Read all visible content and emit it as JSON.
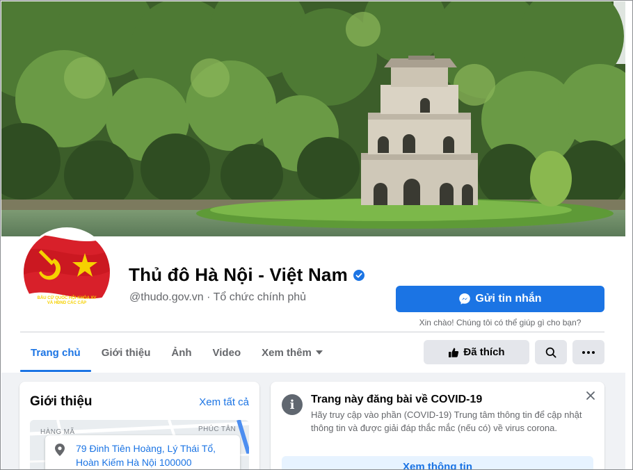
{
  "header": {
    "title": "Thủ đô Hà Nội - Việt Nam",
    "handle": "@thudo.gov.vn · Tổ chức chính phủ",
    "verified": true,
    "avatar_text": [
      "BẦU CỬ QUỐC HỘI KHÓA XV",
      "VÀ HĐND CÁC CẤP",
      "2021-2026"
    ]
  },
  "actions": {
    "message_label": "Gửi tin nhắn",
    "message_hint": "Xin chào! Chúng tôi có thể giúp gì cho bạn?",
    "liked_label": "Đã thích"
  },
  "tabs": [
    {
      "label": "Trang chủ",
      "active": true
    },
    {
      "label": "Giới thiệu",
      "active": false
    },
    {
      "label": "Ảnh",
      "active": false
    },
    {
      "label": "Video",
      "active": false
    },
    {
      "label": "Xem thêm",
      "active": false,
      "dropdown": true
    }
  ],
  "intro": {
    "title": "Giới thiệu",
    "see_all": "Xem tất cả",
    "address": "79 Đinh Tiên Hoàng, Lý Thái Tổ, Hoàn Kiếm Hà Nội 100000",
    "map_labels": [
      "PHÚC TÂN",
      "HÀNG MÃ"
    ]
  },
  "covid": {
    "title": "Trang này đăng bài về COVID-19",
    "body": "Hãy truy cập vào phần (COVID-19) Trung tâm thông tin để cập nhật thông tin và được giải đáp thắc mắc (nếu có) về virus corona.",
    "button": "Xem thông tin"
  },
  "colors": {
    "accent": "#1b74e4",
    "button_gray": "#e4e6eb",
    "background": "#f0f2f5"
  }
}
